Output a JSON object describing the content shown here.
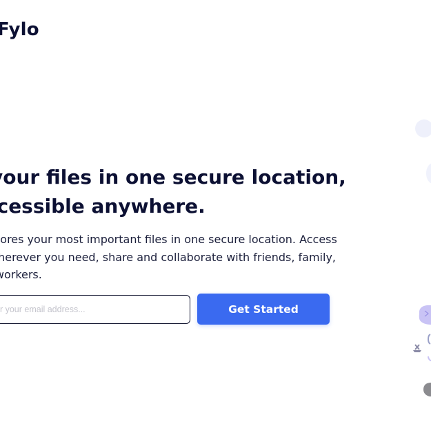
{
  "brand": {
    "logo_text": "Fylo"
  },
  "hero": {
    "headline_line1": "your files in one secure location,",
    "headline_line2": "ccessible anywhere.",
    "subtext_line1": "tores your most important files in one secure location. Access",
    "subtext_line2": "wherever you need, share and collaborate with friends, family,",
    "subtext_line3": "o-workers."
  },
  "signup": {
    "email_placeholder": "er your email address...",
    "cta_label": "Get Started"
  },
  "colors": {
    "heading": "#0c1033",
    "accent": "#3a6af0",
    "illustration_purple": "#c9c3f5"
  },
  "icons": [
    "illustration"
  ]
}
